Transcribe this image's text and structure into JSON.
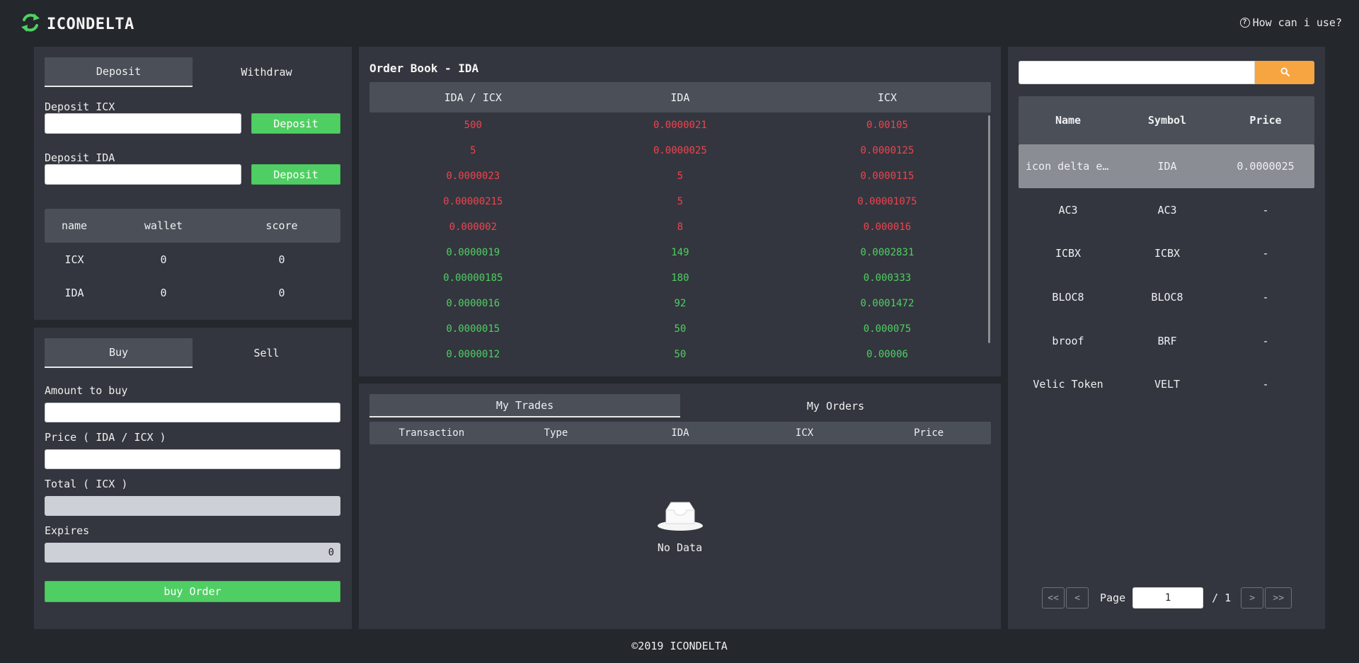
{
  "header": {
    "app_name": "ICONDELTA",
    "help_label": "How can i use?"
  },
  "deposit_panel": {
    "tabs": [
      "Deposit",
      "Withdraw"
    ],
    "deposit_icx_label": "Deposit ICX",
    "deposit_ida_label": "Deposit IDA",
    "deposit_button_label": "Deposit",
    "wallet_table": {
      "headers": [
        "name",
        "wallet",
        "score"
      ],
      "rows": [
        [
          "ICX",
          "0",
          "0"
        ],
        [
          "IDA",
          "0",
          "0"
        ]
      ]
    }
  },
  "trade_panel": {
    "tabs": [
      "Buy",
      "Sell"
    ],
    "amount_label": "Amount to buy",
    "price_label": "Price ( IDA / ICX )",
    "total_label": "Total ( ICX )",
    "expires_label": "Expires",
    "expires_value": "0",
    "submit_label": "buy Order"
  },
  "order_book": {
    "title": "Order Book - IDA",
    "headers": [
      "IDA / ICX",
      "IDA",
      "ICX"
    ],
    "rows": [
      {
        "side": "sell",
        "cells": [
          "500",
          "0.0000021",
          "0.00105"
        ]
      },
      {
        "side": "sell",
        "cells": [
          "5",
          "0.0000025",
          "0.0000125"
        ]
      },
      {
        "side": "sell",
        "cells": [
          "0.0000023",
          "5",
          "0.0000115"
        ]
      },
      {
        "side": "sell",
        "cells": [
          "0.00000215",
          "5",
          "0.00001075"
        ]
      },
      {
        "side": "sell",
        "cells": [
          "0.000002",
          "8",
          "0.000016"
        ]
      },
      {
        "side": "buy",
        "cells": [
          "0.0000019",
          "149",
          "0.0002831"
        ]
      },
      {
        "side": "buy",
        "cells": [
          "0.00000185",
          "180",
          "0.000333"
        ]
      },
      {
        "side": "buy",
        "cells": [
          "0.0000016",
          "92",
          "0.0001472"
        ]
      },
      {
        "side": "buy",
        "cells": [
          "0.0000015",
          "50",
          "0.000075"
        ]
      },
      {
        "side": "buy",
        "cells": [
          "0.0000012",
          "50",
          "0.00006"
        ]
      }
    ],
    "colors": {
      "sell": "#f0434f",
      "buy": "#4fcf63"
    }
  },
  "my_trades": {
    "tabs": [
      "My Trades",
      "My Orders"
    ],
    "headers": [
      "Transaction",
      "Type",
      "IDA",
      "ICX",
      "Price"
    ],
    "empty_text": "No Data",
    "empty_icon": "inbox-icon"
  },
  "tokens": {
    "search_icon": "search-icon",
    "headers": [
      "Name",
      "Symbol",
      "Price"
    ],
    "rows": [
      {
        "cells": [
          "icon delta exchange",
          "IDA",
          "0.0000025"
        ],
        "selected": true
      },
      {
        "cells": [
          "AC3",
          "AC3",
          "-"
        ],
        "selected": false
      },
      {
        "cells": [
          "ICBX",
          "ICBX",
          "-"
        ],
        "selected": false
      },
      {
        "cells": [
          "BLOC8",
          "BLOC8",
          "-"
        ],
        "selected": false
      },
      {
        "cells": [
          "broof",
          "BRF",
          "-"
        ],
        "selected": false
      },
      {
        "cells": [
          "Velic Token",
          "VELT",
          "-"
        ],
        "selected": false
      }
    ],
    "pager": {
      "first": "<<",
      "prev": "<",
      "page_label": "Page",
      "current": "1",
      "of_total": "/ 1",
      "next": ">",
      "last": ">>"
    }
  },
  "footer": {
    "text": "©2019 ICONDELTA"
  },
  "colors": {
    "background": "#24272c",
    "panel": "#33363e",
    "header_row": "#4a4f58",
    "accent_green": "#4fcf63",
    "accent_orange": "#f7a541",
    "sell_red": "#f0434f"
  }
}
